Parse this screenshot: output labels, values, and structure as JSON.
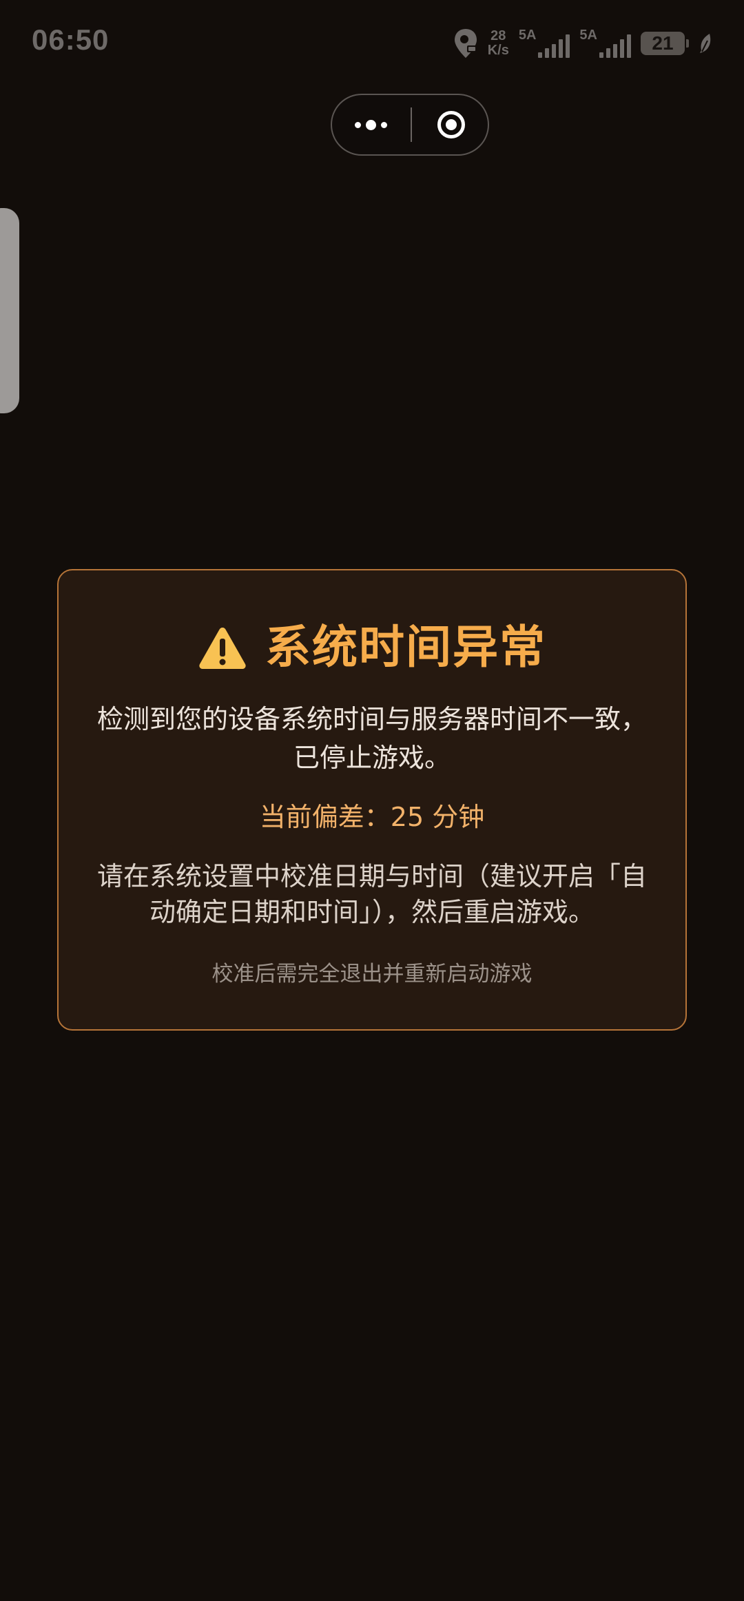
{
  "status_bar": {
    "time": "06:50",
    "net_speed_value": "28",
    "net_speed_unit": "K/s",
    "sim1_label": "5A",
    "sim2_label": "5A",
    "battery_level": "21",
    "icons": [
      "location-pin-icon",
      "signal-icon",
      "signal-icon",
      "battery-icon",
      "leaf-icon"
    ]
  },
  "capsule": {
    "icons": [
      "more-dots-icon",
      "close-target-icon"
    ]
  },
  "dialog": {
    "icon": "warning-icon",
    "title": "系统时间异常",
    "description": "检测到您的设备系统时间与服务器时间不一致，已停止游戏。",
    "difference_label": "当前偏差：",
    "difference_value": "25 分钟",
    "instruction": "请在系统设置中校准日期与时间（建议开启「自动确定日期和时间」），然后重启游戏。",
    "note": "校准后需完全退出并重新启动游戏"
  },
  "colors": {
    "background": "#120d0a",
    "dialog_background": "#261910",
    "dialog_border": "#b67438",
    "title": "#f6ac4b",
    "warning_icon": "#f8c253",
    "difference_text": "#f2b26a",
    "body_text": "#ede4dc",
    "note_text": "#9c928a"
  }
}
